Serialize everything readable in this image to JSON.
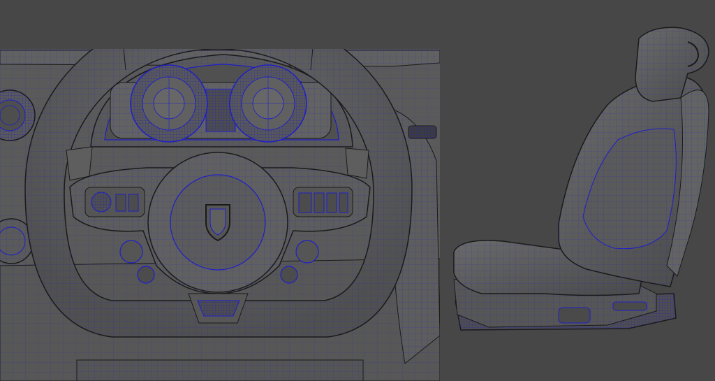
{
  "scene": {
    "background_color": "#474747",
    "surface_color": "#5f5f5f",
    "surface_dark_color": "#4e4e4e",
    "wire_color": "#1e1ec8",
    "edge_color": "#1a1a1a",
    "objects": [
      "steering-wheel-model",
      "instrument-cluster-model",
      "dashboard-model",
      "car-seat-model"
    ]
  }
}
